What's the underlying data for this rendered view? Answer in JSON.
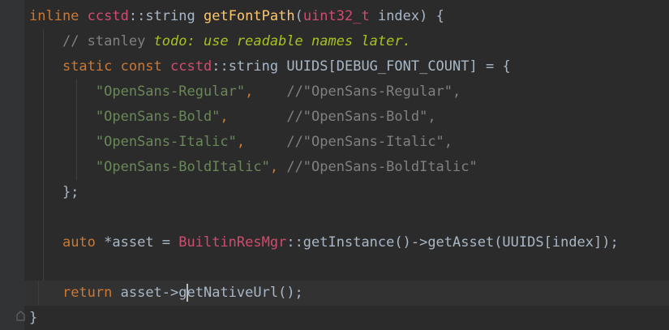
{
  "editor": {
    "lines": [
      {
        "tokens": [
          {
            "t": "kw",
            "v": "inline"
          },
          {
            "t": "txt",
            "v": " "
          },
          {
            "t": "ns",
            "v": "ccstd"
          },
          {
            "t": "txt",
            "v": "::string "
          },
          {
            "t": "fn",
            "v": "getFontPath"
          },
          {
            "t": "txt",
            "v": "("
          },
          {
            "t": "ns",
            "v": "uint32_t"
          },
          {
            "t": "txt",
            "v": " index) {"
          }
        ]
      },
      {
        "tokens": [
          {
            "t": "txt",
            "v": "    "
          },
          {
            "t": "cmt",
            "v": "// stanley "
          },
          {
            "t": "todo",
            "v": "todo: use readable names later."
          }
        ]
      },
      {
        "tokens": [
          {
            "t": "txt",
            "v": "    "
          },
          {
            "t": "kw",
            "v": "static const"
          },
          {
            "t": "txt",
            "v": " "
          },
          {
            "t": "ns",
            "v": "ccstd"
          },
          {
            "t": "txt",
            "v": "::string UUIDS[DEBUG_FONT_COUNT] = {"
          }
        ]
      },
      {
        "tokens": [
          {
            "t": "txt",
            "v": "        "
          },
          {
            "t": "str",
            "v": "\"OpenSans-Regular\""
          },
          {
            "t": "punc",
            "v": ","
          },
          {
            "t": "txt",
            "v": "    "
          },
          {
            "t": "cmt",
            "v": "//\"OpenSans-Regular\","
          }
        ]
      },
      {
        "tokens": [
          {
            "t": "txt",
            "v": "        "
          },
          {
            "t": "str",
            "v": "\"OpenSans-Bold\""
          },
          {
            "t": "punc",
            "v": ","
          },
          {
            "t": "txt",
            "v": "       "
          },
          {
            "t": "cmt",
            "v": "//\"OpenSans-Bold\","
          }
        ]
      },
      {
        "tokens": [
          {
            "t": "txt",
            "v": "        "
          },
          {
            "t": "str",
            "v": "\"OpenSans-Italic\""
          },
          {
            "t": "punc",
            "v": ","
          },
          {
            "t": "txt",
            "v": "     "
          },
          {
            "t": "cmt",
            "v": "//\"OpenSans-Italic\","
          }
        ]
      },
      {
        "tokens": [
          {
            "t": "txt",
            "v": "        "
          },
          {
            "t": "str",
            "v": "\"OpenSans-BoldItalic\""
          },
          {
            "t": "punc",
            "v": ","
          },
          {
            "t": "txt",
            "v": " "
          },
          {
            "t": "cmt",
            "v": "//\"OpenSans-BoldItalic\""
          }
        ]
      },
      {
        "tokens": [
          {
            "t": "txt",
            "v": "    };"
          }
        ]
      },
      {
        "tokens": []
      },
      {
        "tokens": [
          {
            "t": "txt",
            "v": "    "
          },
          {
            "t": "kw",
            "v": "auto"
          },
          {
            "t": "txt",
            "v": " *asset = "
          },
          {
            "t": "ns",
            "v": "BuiltinResMgr"
          },
          {
            "t": "txt",
            "v": "::getInstance()->getAsset(UUIDS[index]);"
          }
        ]
      },
      {
        "tokens": []
      },
      {
        "tokens": [
          {
            "t": "txt",
            "v": "    "
          },
          {
            "t": "kw",
            "v": "return"
          },
          {
            "t": "txt",
            "v": " asset->g"
          },
          {
            "t": "caret",
            "v": ""
          },
          {
            "t": "txt",
            "v": "etNativeUrl();"
          }
        ],
        "current": true
      },
      {
        "tokens": [
          {
            "t": "txt",
            "v": "}"
          }
        ]
      }
    ]
  }
}
